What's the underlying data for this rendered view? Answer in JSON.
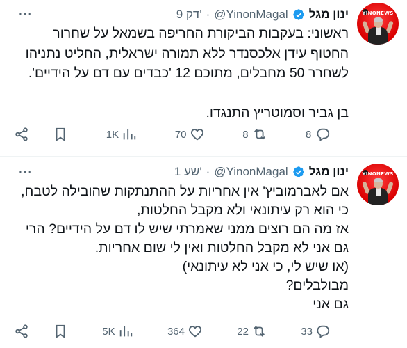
{
  "tweets": [
    {
      "display_name": "ינון מגל",
      "handle": "@YinonMagal",
      "dot": "·",
      "time": "9 דק'",
      "lines": [
        "ראשוני: בעקבות הביקורת החריפה בשמאל על שחרור",
        "החטוף עידן אלכסנדר ללא תמורה ישראלית, החליט נתניהו",
        "לשחרר 50 מחבלים, מתוכם 12 'כבדים עם דם על הידיים'.",
        "",
        "בן גביר וסמוטריץ התנגדו."
      ],
      "replies": "8",
      "reposts": "8",
      "likes": "70",
      "views": "1K",
      "avatar_logo": "YINONEWS"
    },
    {
      "display_name": "ינון מגל",
      "handle": "@YinonMagal",
      "dot": "·",
      "time": "1 שע'",
      "lines": [
        "אם לאברמוביץ' אין אחריות על ההתנתקות שהובילה לטבח,",
        "כי הוא רק עיתונאי ולא מקבל החלטות,",
        "אז מה הם רוצים ממני שאמרתי שיש לו דם על הידיים? הרי",
        "גם אני לא מקבל החלטות ואין לי שום אחריות.",
        "(או שיש לי, כי אני לא עיתונאי)",
        "מבולבלים?",
        "גם אני"
      ],
      "replies": "33",
      "reposts": "22",
      "likes": "364",
      "views": "5K",
      "avatar_logo": "YINONEWS"
    }
  ],
  "icons": {
    "more": "⋯",
    "verified_color": "#1d9bf0",
    "accent_red": "#d90000"
  }
}
